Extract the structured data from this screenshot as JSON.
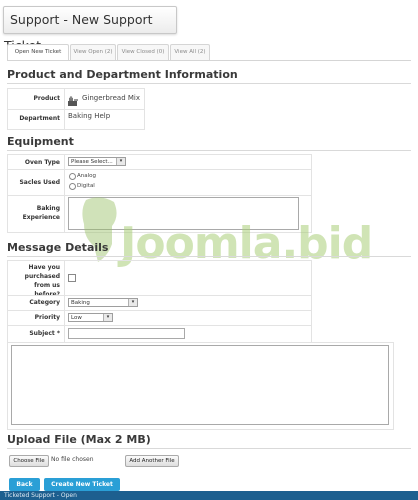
{
  "page": {
    "title": "Support - New Support Ticket"
  },
  "tabs": [
    {
      "label": "Open New Ticket"
    },
    {
      "label": "View Open (2)"
    },
    {
      "label": "View Closed (0)"
    },
    {
      "label": "View All (2)"
    }
  ],
  "product_section": {
    "heading": "Product and Department Information",
    "product_label": "Product",
    "product_value": "Gingerbread Mix",
    "department_label": "Department",
    "department_value": "Baking Help"
  },
  "equipment": {
    "heading": "Equipment",
    "oven_type_label": "Oven Type",
    "oven_type_value": "Please Select...",
    "scales_label": "Sacles Used",
    "scales_options": [
      "Analog",
      "Digital"
    ],
    "experience_label": "Baking Experience"
  },
  "message": {
    "heading": "Message Details",
    "purchased_label": "Have you purchased from us before?",
    "category_label": "Category",
    "category_value": "Baking",
    "priority_label": "Priority",
    "priority_value": "Low",
    "subject_label": "Subject *"
  },
  "upload": {
    "heading": "Upload File (Max 2 MB)",
    "choose_label": "Choose File",
    "no_file_text": "No file chosen",
    "add_another_label": "Add Another File"
  },
  "actions": {
    "back_label": "Back",
    "create_label": "Create New Ticket"
  },
  "footer": {
    "text": "Ticketed Support - Open"
  },
  "watermark": {
    "text": "Joomla.bid"
  }
}
